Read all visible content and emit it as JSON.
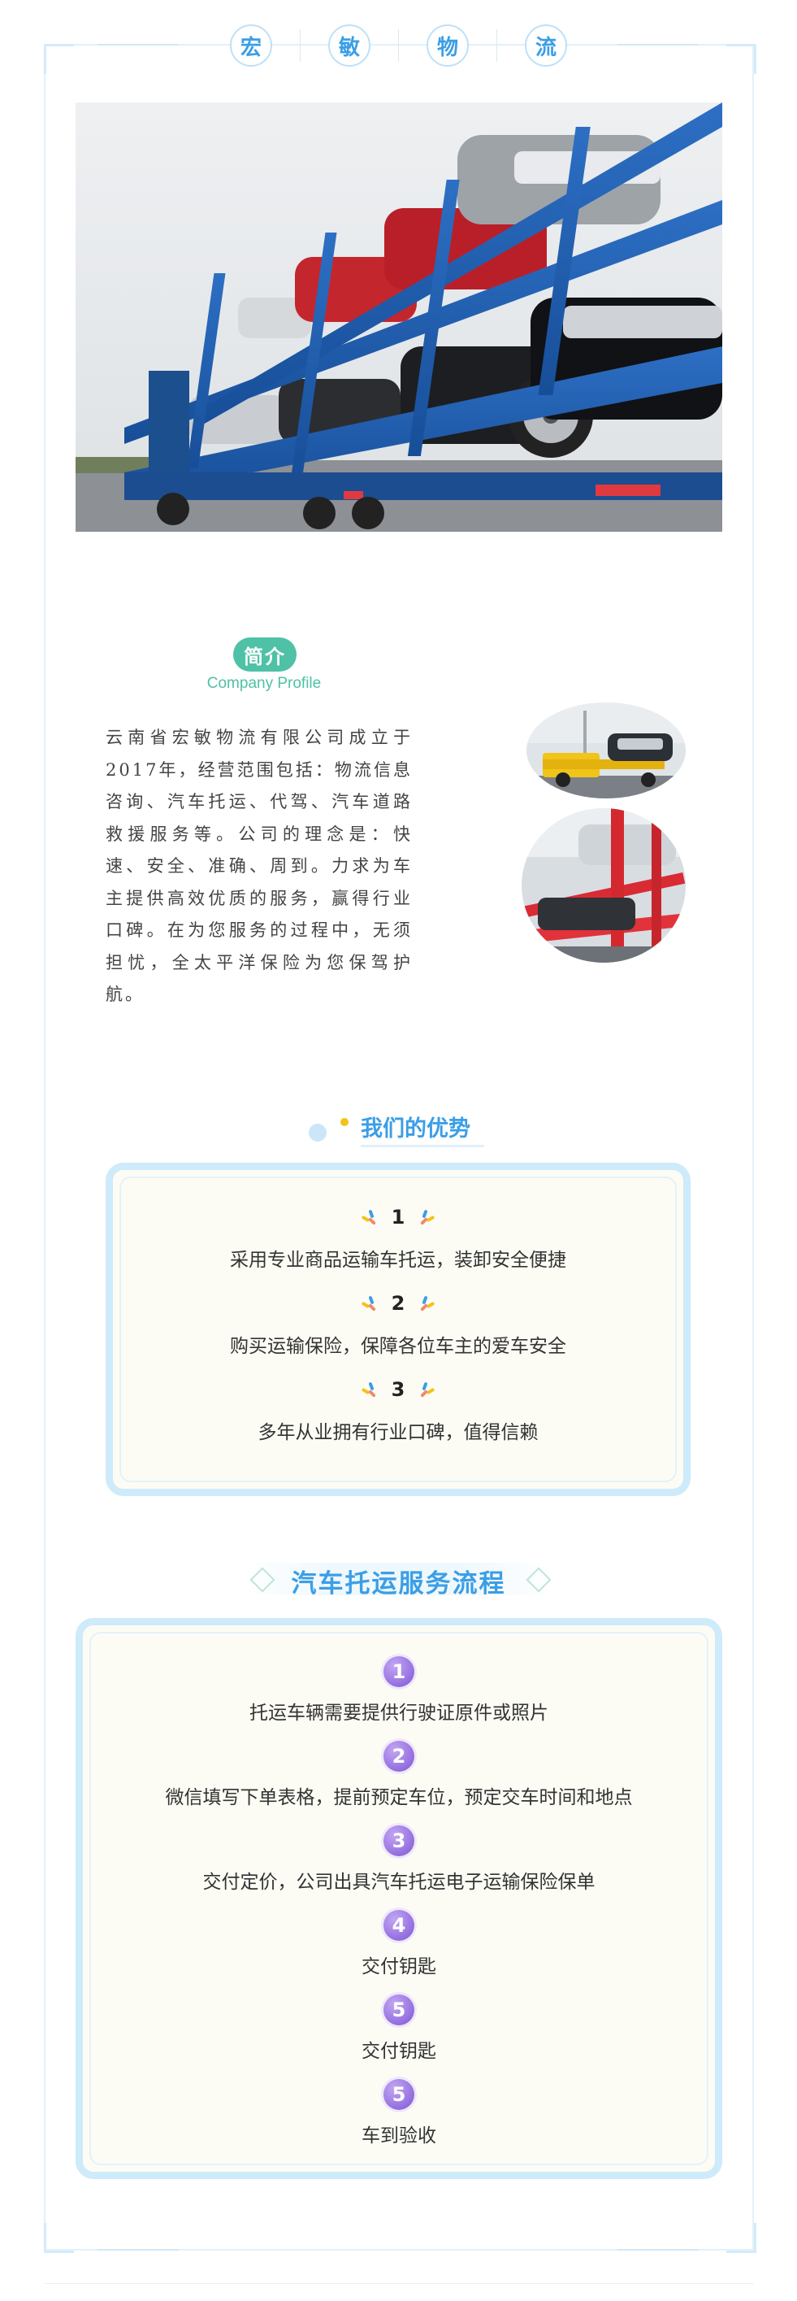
{
  "header": {
    "title_chars": [
      "宏",
      "敏",
      "物",
      "流"
    ]
  },
  "profile": {
    "badge": "简介",
    "subtitle": "Company Profile",
    "text": "云南省宏敏物流有限公司成立于2017年，经营范围包括：物流信息咨询、汽车托运、代驾、汽车道路救援服务等。公司的理念是：快速、安全、准确、周到。力求为车主提供高效优质的服务，赢得行业口碑。在为您服务的过程中，无须担忧，全太平洋保险为您保驾护航。"
  },
  "advantages": {
    "title": "我们的优势",
    "items": [
      {
        "num": "1",
        "text": "采用专业商品运输车托运，装卸安全便捷"
      },
      {
        "num": "2",
        "text": "购买运输保险，保障各位车主的爱车安全"
      },
      {
        "num": "3",
        "text": "多年从业拥有行业口碑，值得信赖"
      }
    ]
  },
  "process": {
    "title": "汽车托运服务流程",
    "steps": [
      {
        "num": "1",
        "text": "托运车辆需要提供行驶证原件或照片"
      },
      {
        "num": "2",
        "text": "微信填写下单表格，提前预定车位，预定交车时间和地点"
      },
      {
        "num": "3",
        "text": "交付定价，公司出具汽车托运电子运输保险保单"
      },
      {
        "num": "4",
        "text": "交付钥匙"
      },
      {
        "num": "5",
        "text": "交付钥匙"
      },
      {
        "num": "5",
        "text": "车到验收"
      }
    ]
  },
  "colors": {
    "accent_blue": "#3b9ee6",
    "profile_green": "#4ec1a6",
    "box_border": "#cdebfa",
    "step_purple": "#9a76e2",
    "accent_yellow": "#f4c21a"
  }
}
